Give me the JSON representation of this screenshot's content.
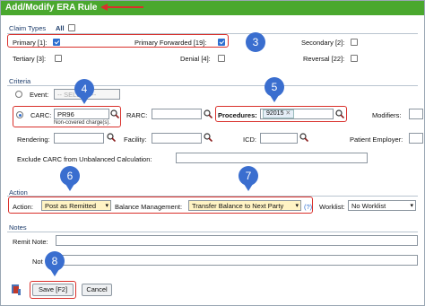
{
  "window": {
    "title": "Add/Modify ERA Rule"
  },
  "claim_types": {
    "label": "Claim Types",
    "all_label": "All",
    "items": [
      {
        "label": "Primary [1]:",
        "checked": true
      },
      {
        "label": "Primary Forwarded [19]:",
        "checked": true
      },
      {
        "label": "Secondary [2]:",
        "checked": false
      },
      {
        "label": "Tertiary [3]:",
        "checked": false
      },
      {
        "label": "Denial [4]:",
        "checked": false
      },
      {
        "label": "Reversal [22]:",
        "checked": false
      }
    ]
  },
  "criteria": {
    "label": "Criteria",
    "event_label": "Event:",
    "event_placeholder": "-- SELECT --",
    "carc_label": "CARC:",
    "carc_value": "PR96",
    "carc_note": "Non-covered charge(s).",
    "rarc_label": "RARC:",
    "procedures_label": "Procedures:",
    "procedure_tag": "92015",
    "modifiers_label": "Modifiers:",
    "rendering_label": "Rendering:",
    "facility_label": "Facility:",
    "icd_label": "ICD:",
    "patient_employer_label": "Patient Employer:",
    "exclude_label": "Exclude CARC from Unbalanced Calculation:"
  },
  "action": {
    "label": "Action",
    "action_label": "Action:",
    "action_value": "Post as Remitted",
    "balance_label": "Balance Management:",
    "balance_value": "Transfer Balance to Next Party",
    "help": "(?)",
    "worklist_label": "Worklist:",
    "worklist_value": "No Worklist"
  },
  "notes": {
    "label": "Notes",
    "remit_note_label": "Remit Note:",
    "note_label": "Not"
  },
  "buttons": {
    "save": "Save [F2]",
    "cancel": "Cancel"
  },
  "callouts": [
    "3",
    "4",
    "5",
    "6",
    "7",
    "8"
  ],
  "colors": {
    "title_bar": "#4aa82e",
    "highlight": "#d9302b",
    "callout": "#3a6ecf",
    "select_highlight": "#fff3c4"
  }
}
